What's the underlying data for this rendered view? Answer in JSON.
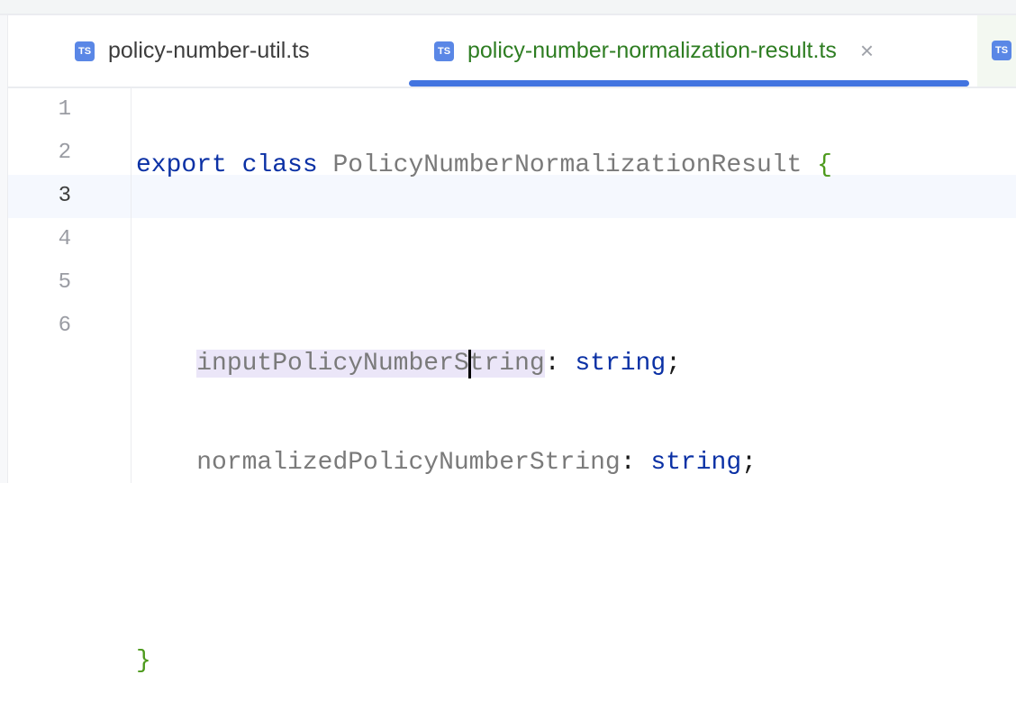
{
  "tabs": [
    {
      "label": "policy-number-util.ts",
      "icon": "ts-file-icon",
      "active": false
    },
    {
      "label": "policy-number-normalization-result.ts",
      "icon": "ts-file-icon",
      "active": true
    },
    {
      "label": "",
      "icon": "ts-test-file-icon",
      "active": false
    }
  ],
  "ts_icon_text": "TS",
  "close_icon": "×",
  "gutter": {
    "lines": [
      "1",
      "2",
      "3",
      "4",
      "5",
      "6"
    ],
    "current": "3"
  },
  "code": {
    "l1": {
      "kw1": "export",
      "kw2": "class",
      "name": "PolicyNumberNormalizationResult",
      "brace": "{"
    },
    "l3": {
      "ident_a": "inputPolicyNumberS",
      "ident_b": "tring",
      "colon": ":",
      "type": "string",
      "semi": ";"
    },
    "l4": {
      "ident": "normalizedPolicyNumberString",
      "colon": ":",
      "type": "string",
      "semi": ";"
    },
    "l6": {
      "brace": "}"
    }
  },
  "colors": {
    "keyword": "#0b31a5",
    "identifier": "#7a7a7a",
    "brace": "#4d9a1c",
    "active_tab": "#2e7d22",
    "accent": "#4274e0"
  }
}
